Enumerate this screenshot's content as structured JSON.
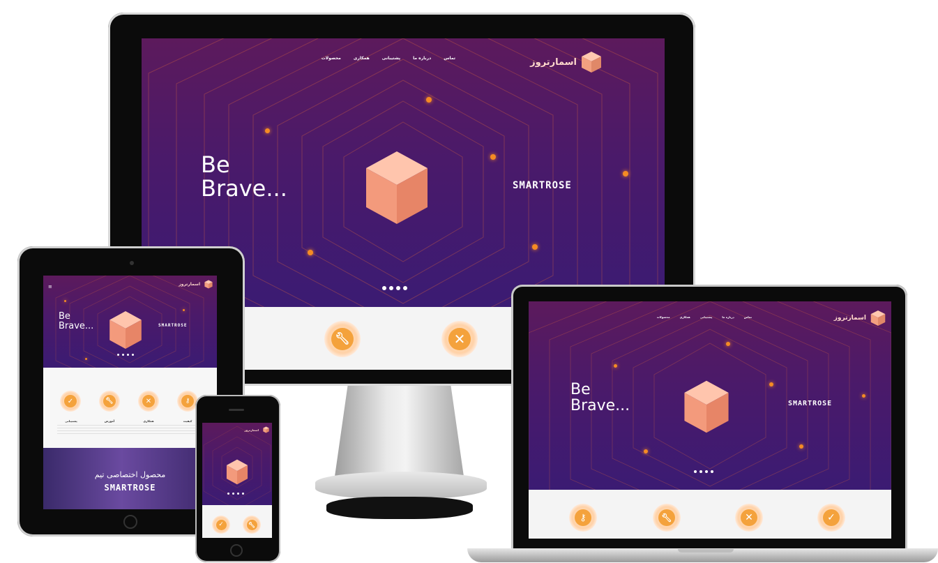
{
  "nav": {
    "items": [
      "محصولات",
      "همکاری",
      "پشتیبانی",
      "درباره ما",
      "تماس"
    ]
  },
  "brand": {
    "name": "اسمارتروز",
    "tagline": "SMARTROSE"
  },
  "hero": {
    "headline_line1": "Be",
    "headline_line2": "Brave...",
    "wordmark": "SMARTROSE",
    "slides": 4
  },
  "features": {
    "icons": [
      "key-icon",
      "wrench-icon",
      "close-icon",
      "check-icon"
    ],
    "titles": [
      "پشتیبانی",
      "آموزش",
      "همکاری",
      "کیفیت"
    ]
  },
  "product_banner": {
    "line1": "محصول اختصاصی تیم",
    "line2": "SMARTROSE"
  },
  "colors": {
    "hero_top": "#5c1a5c",
    "hero_bottom": "#3b1b73",
    "accent_orange": "#f4a23c",
    "cube_face": "#f5a184"
  }
}
